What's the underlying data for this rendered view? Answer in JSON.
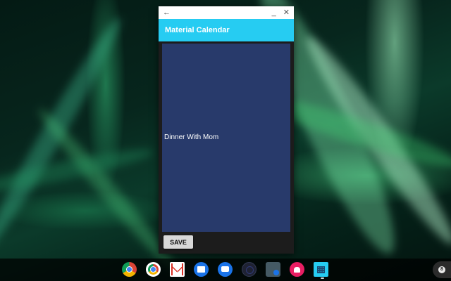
{
  "window": {
    "back_symbol": "←",
    "minimize_symbol": "_",
    "close_symbol": "✕"
  },
  "app": {
    "title": "Material Calendar",
    "accent_color": "#26ccf2",
    "content_background": "#283a6b"
  },
  "event": {
    "value": "Dinner With Mom"
  },
  "actions": {
    "save_label": "SAVE"
  },
  "shelf": {
    "apps": [
      {
        "name": "chrome",
        "icon": "chrome-icon"
      },
      {
        "name": "chrome-beta",
        "icon": "chrome-beta-icon"
      },
      {
        "name": "gmail",
        "icon": "gmail-icon"
      },
      {
        "name": "files",
        "icon": "files-icon"
      },
      {
        "name": "messages",
        "icon": "messages-icon"
      },
      {
        "name": "dark-app",
        "icon": "dark-circle-icon"
      },
      {
        "name": "calculator",
        "icon": "calculator-icon"
      },
      {
        "name": "android-app",
        "icon": "android-icon"
      },
      {
        "name": "material-calendar",
        "icon": "calendar-icon",
        "active": true
      }
    ],
    "status_glyph": "8"
  }
}
